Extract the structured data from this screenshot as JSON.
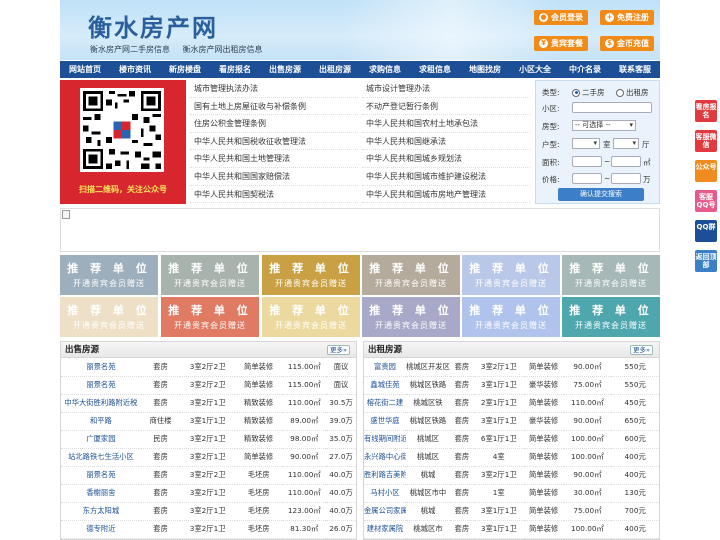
{
  "header": {
    "title": "衡水房产网",
    "sub_links": [
      "衡水房产网二手房信息",
      "衡水房产网出租房信息"
    ],
    "buttons": {
      "login": "会员登录",
      "register": "免费注册",
      "vip": "贵宾套餐",
      "recharge": "金币充值"
    }
  },
  "nav": [
    "网站首页",
    "楼市资讯",
    "新房楼盘",
    "看房报名",
    "出售房源",
    "出租房源",
    "求购信息",
    "求租信息",
    "地图找房",
    "小区大全",
    "中介名录",
    "联系客服"
  ],
  "qr": {
    "caption": "扫描二维码，关注公众号"
  },
  "links": {
    "left": [
      "城市管理执法办法",
      "国有土地上房屋征收与补偿条例",
      "住房公积金管理条例",
      "中华人民共和国税收征收管理法",
      "中华人民共和国土地管理法",
      "中华人民共和国国家赔偿法",
      "中华人民共和国契税法"
    ],
    "right": [
      "城市设计管理办法",
      "不动产登记暂行条例",
      "中华人民共和国农村土地承包法",
      "中华人民共和国继承法",
      "中华人民共和国城乡规划法",
      "中华人民共和国城市维护建设税法",
      "中华人民共和国城市房地产管理法"
    ]
  },
  "search": {
    "type_label": "类型:",
    "type_options": [
      "二手房",
      "出租房"
    ],
    "type_selected": "二手房",
    "community_label": "小区:",
    "room_type_label": "房型:",
    "room_type_value": "-- 可选择 --",
    "layout_label": "户型:",
    "room_unit": "室",
    "hall_unit": "厅",
    "area_label": "面积:",
    "area_unit": "㎡",
    "price_label": "价格:",
    "price_unit": "万",
    "range_sep": "~",
    "submit": "确认提交搜索"
  },
  "promo": {
    "line1": "推 荐 单 位",
    "line2": "开通贵宾会员赠送",
    "colors": [
      "#9daebd",
      "#a8b3ae",
      "#c9a043",
      "#b5ab9c",
      "#b9c7e8",
      "#a6b8b7",
      "#ede0c6",
      "#e07a63",
      "#ecd9a0",
      "#a8a8c8",
      "#b0c3ec",
      "#4ea7ad"
    ]
  },
  "sale": {
    "title": "出售房源",
    "more": "更多»",
    "rows": [
      [
        "丽景名苑",
        "套房",
        "3室2厅2卫",
        "简单装修",
        "115.00㎡",
        "面议"
      ],
      [
        "丽景名苑",
        "套房",
        "3室2厅2卫",
        "简单装修",
        "115.00㎡",
        "面议"
      ],
      [
        "中华大街胜利路附近税",
        "套房",
        "3室2厅1卫",
        "精致装修",
        "110.00㎡",
        "30.5万"
      ],
      [
        "和平路",
        "商住楼",
        "3室1厅1卫",
        "精致装修",
        "89.00㎡",
        "39.0万"
      ],
      [
        "广厦家园",
        "民房",
        "3室2厅1卫",
        "精致装修",
        "98.00㎡",
        "35.0万"
      ],
      [
        "站北路铁七生活小区",
        "套房",
        "3室2厅1卫",
        "简单装修",
        "90.00㎡",
        "27.0万"
      ],
      [
        "丽景名苑",
        "套房",
        "3室2厅2卫",
        "毛坯房",
        "110.00㎡",
        "40.0万"
      ],
      [
        "香榭丽舍",
        "套房",
        "3室2厅1卫",
        "毛坯房",
        "110.00㎡",
        "40.0万"
      ],
      [
        "东方太阳城",
        "套房",
        "3室2厅1卫",
        "毛坯房",
        "123.00㎡",
        "40.0万"
      ],
      [
        "德专附近",
        "套房",
        "3室2厅1卫",
        "毛坯房",
        "81.30㎡",
        "26.0万"
      ]
    ]
  },
  "rent": {
    "title": "出租房源",
    "more": "更多»",
    "rows": [
      [
        "富贵园",
        "桃城区开发区",
        "套房",
        "3室2厅1卫",
        "简单装修",
        "90.00㎡",
        "550元"
      ],
      [
        "鑫城佳苑",
        "桃城区铁路",
        "套房",
        "3室1厅1卫",
        "豪华装修",
        "75.00㎡",
        "550元"
      ],
      [
        "榕花街二建",
        "桃城区铁",
        "套房",
        "2室1厅1卫",
        "简单装修",
        "110.00㎡",
        "450元"
      ],
      [
        "盛世华庭",
        "桃城区铁路",
        "套房",
        "3室1厅1卫",
        "豪华装修",
        "90.00㎡",
        "650元"
      ],
      [
        "有线期间附近",
        "桃城区",
        "套房",
        "6室1厅1卫",
        "简单装修",
        "100.00㎡",
        "600元"
      ],
      [
        "永兴路中心街",
        "桃城区",
        "套房",
        "4室",
        "简单装修",
        "100.00㎡",
        "400元"
      ],
      [
        "胜利路吉美附近",
        "桃城",
        "套房",
        "3室2厅1卫",
        "简单装修",
        "90.00㎡",
        "400元"
      ],
      [
        "马村小区",
        "桃城区市中",
        "套房",
        "1室",
        "简单装修",
        "30.00㎡",
        "130元"
      ],
      [
        "金属公司家属楼",
        "桃城",
        "套房",
        "3室1厅1卫",
        "简单装修",
        "75.00㎡",
        "700元"
      ],
      [
        "建材家属院",
        "桃城区市",
        "套房",
        "3室1厅1卫",
        "简单装修",
        "100.00㎡",
        "400元"
      ]
    ]
  },
  "float": [
    {
      "label": "看房报名",
      "color": "#e03a3e"
    },
    {
      "label": "客服微信",
      "color": "#e03a3e"
    },
    {
      "label": "公众号",
      "color": "#ef8b1f"
    },
    {
      "label": "客服QQ号",
      "color": "#e85a8a"
    },
    {
      "label": "QQ群",
      "color": "#1c4f95"
    },
    {
      "label": "返回顶部",
      "color": "#3a80c6"
    }
  ]
}
